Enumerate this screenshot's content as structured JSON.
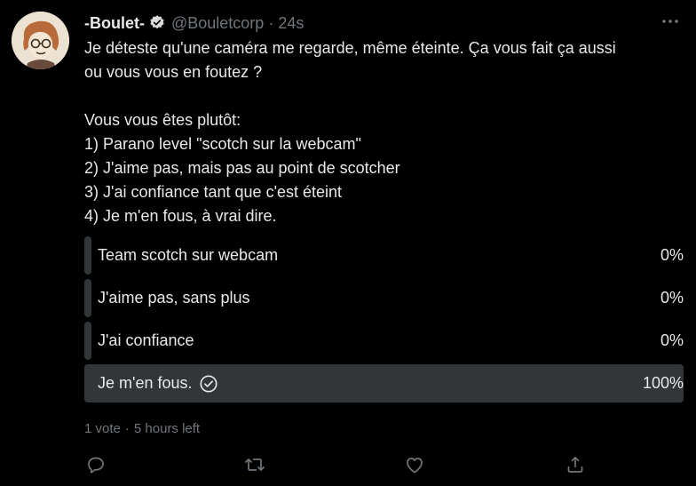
{
  "author": {
    "display_name": "-Boulet-",
    "handle": "@Bouletcorp",
    "separator": "·",
    "timestamp": "24s"
  },
  "tweet": {
    "lines": [
      "Je déteste qu'une caméra me regarde, même éteinte. Ça vous fait ça aussi",
      "ou vous vous en foutez ?",
      "",
      "Vous vous êtes plutôt:",
      "1) Parano level \"scotch sur la webcam\"",
      "2) J'aime pas, mais pas au point de scotcher",
      "3) J'ai confiance tant que c'est éteint",
      "4) Je m'en fous, à vrai dire."
    ]
  },
  "poll": {
    "options": [
      {
        "label": "Team scotch sur webcam",
        "percent_text": "0%",
        "percent": 0
      },
      {
        "label": "J'aime pas, sans plus",
        "percent_text": "0%",
        "percent": 0
      },
      {
        "label": "J'ai confiance",
        "percent_text": "0%",
        "percent": 0
      },
      {
        "label": "Je m'en fous.",
        "percent_text": "100%",
        "percent": 100,
        "selected": true
      }
    ],
    "votes": "1 vote",
    "separator": "·",
    "time_left": "5 hours left"
  },
  "icons": {
    "verified": "verified-badge-icon",
    "more": "more-icon",
    "reply": "reply-icon",
    "retweet": "retweet-icon",
    "like": "like-icon",
    "share": "share-icon",
    "check": "check-circle-icon"
  },
  "colors": {
    "background": "#000000",
    "text": "#e7e9ea",
    "muted": "#71767b",
    "poll_fill": "#333639"
  }
}
